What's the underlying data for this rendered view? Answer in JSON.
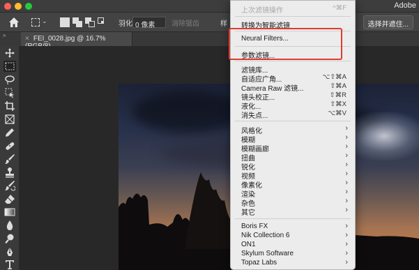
{
  "titlebar": {
    "app_title": "Adobe",
    "traffic_colors": [
      "#fe5f57",
      "#febc2e",
      "#28c840"
    ]
  },
  "options_bar": {
    "feather_label": "羽化:",
    "feather_value": "0 像素",
    "antialias_label": "消除锯齿",
    "style_label": "样",
    "select_mask_label": "选择并遮住..."
  },
  "tabbar": {
    "collapse_glyph": "»",
    "doc_tab": {
      "close_glyph": "×",
      "title": "FEI_0028.jpg @ 16.7%(RGB/8)"
    }
  },
  "toolbar": {
    "tools": [
      {
        "name": "move-tool",
        "icon": "move-icon"
      },
      {
        "name": "marquee-tool",
        "icon": "marquee-icon"
      },
      {
        "name": "lasso-tool",
        "icon": "lasso-icon"
      },
      {
        "name": "object-select-tool",
        "icon": "object-select-icon"
      },
      {
        "name": "crop-tool",
        "icon": "crop-icon"
      },
      {
        "name": "frame-tool",
        "icon": "frame-icon"
      },
      {
        "name": "eyedropper-tool",
        "icon": "eyedropper-icon"
      },
      {
        "name": "healing-tool",
        "icon": "bandage-icon"
      },
      {
        "name": "brush-tool",
        "icon": "brush-icon"
      },
      {
        "name": "stamp-tool",
        "icon": "stamp-icon"
      },
      {
        "name": "history-brush-tool",
        "icon": "history-brush-icon"
      },
      {
        "name": "eraser-tool",
        "icon": "eraser-icon"
      },
      {
        "name": "gradient-tool",
        "icon": "gradient-icon"
      },
      {
        "name": "blur-tool",
        "icon": "drop-icon"
      },
      {
        "name": "dodge-tool",
        "icon": "dodge-icon"
      },
      {
        "name": "pen-tool",
        "icon": "pen-icon"
      },
      {
        "name": "type-tool",
        "icon": "type-icon"
      }
    ]
  },
  "menu": {
    "last_filter": {
      "label": "上次滤镜操作",
      "shortcut": "^⌘F"
    },
    "convert_smart": {
      "label": "转换为智能滤镜"
    },
    "neural_filters": {
      "label": "Neural Filters..."
    },
    "parametric": {
      "label": "参数滤镜..."
    },
    "gallery": {
      "label": "滤镜库..."
    },
    "adaptive_wide": {
      "label": "自适应广角...",
      "shortcut": "⌥⇧⌘A"
    },
    "camera_raw": {
      "label": "Camera Raw 滤镜...",
      "shortcut": "⇧⌘A"
    },
    "lens_correction": {
      "label": "镜头校正...",
      "shortcut": "⇧⌘R"
    },
    "liquify": {
      "label": "液化...",
      "shortcut": "⇧⌘X"
    },
    "vanishing_point": {
      "label": "消失点...",
      "shortcut": "⌥⌘V"
    },
    "submenus_a": [
      "风格化",
      "模糊",
      "模糊画廊",
      "扭曲",
      "锐化",
      "视频",
      "像素化",
      "渲染",
      "杂色",
      "其它"
    ],
    "submenus_b": [
      "Boris FX",
      "Nik Collection 6",
      "ON1",
      "Skylum Software",
      "Topaz Labs"
    ],
    "arrow_glyph": "›",
    "highlight_color": "#e03a2f"
  }
}
